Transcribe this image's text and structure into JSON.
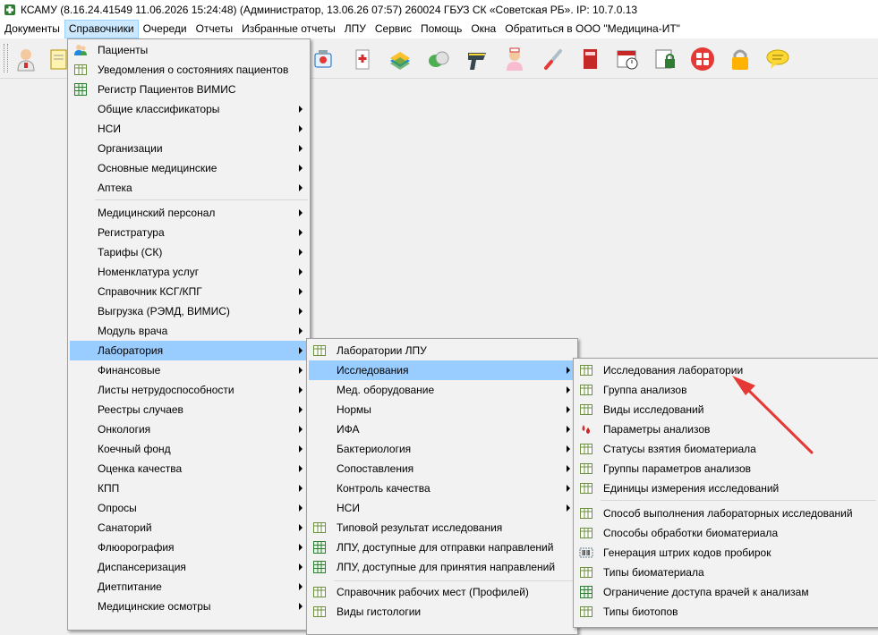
{
  "title": {
    "text": "КСАМУ (8.16.24.41549 11.06.2026 15:24:48) (Администратор, 13.06.26 07:57)  260024 ГБУЗ СК «Советская РБ». IP: 10.7.0.13",
    "icon": "app-icon"
  },
  "menubar": {
    "items": [
      {
        "label": "Документы"
      },
      {
        "label": "Справочники"
      },
      {
        "label": "Очереди"
      },
      {
        "label": "Отчеты"
      },
      {
        "label": "Избранные отчеты"
      },
      {
        "label": "ЛПУ"
      },
      {
        "label": "Сервис"
      },
      {
        "label": "Помощь"
      },
      {
        "label": "Окна"
      },
      {
        "label": "Обратиться в ООО \"Медицина-ИТ\""
      }
    ],
    "active": "Справочники"
  },
  "toolbar": {
    "icons": [
      "doctor-icon",
      "notes-icon",
      "patients-icon",
      "medicine-icon",
      "first-aid-icon",
      "books-icon",
      "pills-icon",
      "barcode-scanner-icon",
      "nurse-icon",
      "thermometer-icon",
      "red-book-icon",
      "calendar-clock-icon",
      "document-lock-icon",
      "apps-icon",
      "padlock-icon",
      "chat-icon"
    ]
  },
  "menu_spravochniki": {
    "items": [
      {
        "label": "Пациенты",
        "icon": "patients-icon",
        "submenu": false
      },
      {
        "label": "Уведомления о состояниях пациентов",
        "icon": "table-icon",
        "submenu": false
      },
      {
        "label": "Регистр Пациентов ВИМИС",
        "icon": "grid-icon",
        "submenu": false
      },
      {
        "label": "Общие классификаторы",
        "submenu": true
      },
      {
        "label": "НСИ",
        "submenu": true
      },
      {
        "label": "Организации",
        "submenu": true
      },
      {
        "label": "Основные медицинские",
        "submenu": true
      },
      {
        "label": "Аптека",
        "submenu": true
      },
      {
        "label": "Медицинский персонал",
        "submenu": true
      },
      {
        "label": "Регистратура",
        "submenu": true
      },
      {
        "label": "Тарифы (СК)",
        "submenu": true
      },
      {
        "label": "Номенклатура услуг",
        "submenu": true
      },
      {
        "label": "Справочник КСГ/КПГ",
        "submenu": true
      },
      {
        "label": "Выгрузка (РЭМД, ВИМИС)",
        "submenu": true
      },
      {
        "label": "Модуль врача",
        "submenu": true
      },
      {
        "label": "Лаборатория",
        "submenu": true,
        "selected": true
      },
      {
        "label": "Финансовые",
        "submenu": true
      },
      {
        "label": "Листы нетрудоспособности",
        "submenu": true
      },
      {
        "label": "Реестры случаев",
        "submenu": true
      },
      {
        "label": "Онкология",
        "submenu": true
      },
      {
        "label": "Коечный фонд",
        "submenu": true
      },
      {
        "label": "Оценка качества",
        "submenu": true
      },
      {
        "label": "КПП",
        "submenu": true
      },
      {
        "label": "Опросы",
        "submenu": true
      },
      {
        "label": "Санаторий",
        "submenu": true
      },
      {
        "label": "Флюорография",
        "submenu": true
      },
      {
        "label": "Диспансеризация",
        "submenu": true
      },
      {
        "label": "Диетпитание",
        "submenu": true
      },
      {
        "label": "Медицинские осмотры",
        "submenu": true
      }
    ]
  },
  "menu_laboratoriya": {
    "items": [
      {
        "label": "Лаборатории ЛПУ",
        "icon": "table-icon",
        "submenu": false
      },
      {
        "label": "Исследования",
        "submenu": true,
        "selected": true
      },
      {
        "label": "Мед. оборудование",
        "submenu": true
      },
      {
        "label": "Нормы",
        "submenu": true
      },
      {
        "label": "ИФА",
        "submenu": true
      },
      {
        "label": "Бактериология",
        "submenu": true
      },
      {
        "label": "Сопоставления",
        "submenu": true
      },
      {
        "label": "Контроль качества",
        "submenu": true
      },
      {
        "label": "НСИ",
        "submenu": true
      },
      {
        "label": "Типовой результат исследования",
        "icon": "table-icon",
        "submenu": false
      },
      {
        "label": "ЛПУ, доступные для отправки направлений",
        "icon": "grid-icon",
        "submenu": false
      },
      {
        "label": "ЛПУ, доступные для принятия направлений",
        "icon": "grid-icon",
        "submenu": false
      },
      {
        "label": "Справочник рабочих мест (Профилей)",
        "icon": "table-icon",
        "submenu": false
      },
      {
        "label": "Виды гистологии",
        "icon": "table-icon",
        "submenu": false
      }
    ]
  },
  "menu_issledovaniya": {
    "items": [
      {
        "label": "Исследования лаборатории",
        "icon": "table-icon"
      },
      {
        "label": "Группа анализов",
        "icon": "table-icon"
      },
      {
        "label": "Виды исследований",
        "icon": "table-icon"
      },
      {
        "label": "Параметры анализов",
        "icon": "blood-drops-icon"
      },
      {
        "label": "Статусы взятия биоматериала",
        "icon": "table-icon"
      },
      {
        "label": "Группы параметров анализов",
        "icon": "table-icon"
      },
      {
        "label": "Единицы измерения исследований",
        "icon": "table-icon"
      },
      {
        "label": "Способ выполнения лабораторных исследований",
        "icon": "table-icon"
      },
      {
        "label": "Способы обработки биоматериала",
        "icon": "table-icon"
      },
      {
        "label": "Генерация штрих кодов пробирок",
        "icon": "barcode-icon"
      },
      {
        "label": "Типы биоматериала",
        "icon": "table-icon"
      },
      {
        "label": "Ограничение доступа врачей к анализам",
        "icon": "grid-icon"
      },
      {
        "label": "Типы биотопов",
        "icon": "table-icon"
      }
    ]
  },
  "colors": {
    "selection": "#99ccff",
    "menubar_active": "#cce8ff",
    "annotation_arrow": "#e53935"
  }
}
